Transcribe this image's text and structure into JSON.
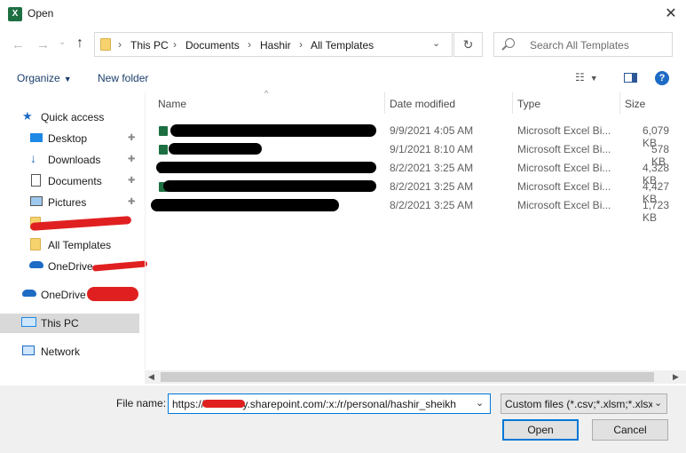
{
  "window": {
    "title": "Open",
    "app_icon_letter": "X"
  },
  "address": {
    "segments": [
      "This PC",
      "Documents",
      "Hashir",
      "All Templates"
    ]
  },
  "search": {
    "placeholder": "Search All Templates"
  },
  "toolbar": {
    "organize": "Organize",
    "new_folder": "New folder",
    "help": "?"
  },
  "columns": {
    "name": "Name",
    "date": "Date modified",
    "type": "Type",
    "size": "Size"
  },
  "files": [
    {
      "date": "9/9/2021 4:05 AM",
      "type": "Microsoft Excel Bi...",
      "size": "6,079 KB"
    },
    {
      "date": "9/1/2021 8:10 AM",
      "type": "Microsoft Excel Bi...",
      "size": "578 KB"
    },
    {
      "date": "8/2/2021 3:25 AM",
      "type": "Microsoft Excel Bi...",
      "size": "4,328 KB"
    },
    {
      "date": "8/2/2021 3:25 AM",
      "type": "Microsoft Excel Bi...",
      "size": "4,427 KB"
    },
    {
      "date": "8/2/2021 3:25 AM",
      "type": "Microsoft Excel Bi...",
      "size": "1,723 KB"
    }
  ],
  "sidebar": {
    "items": [
      {
        "label": "Quick access",
        "icon": "star-icon"
      },
      {
        "label": "Desktop",
        "icon": "desktop-icon"
      },
      {
        "label": "Downloads",
        "icon": "download-icon"
      },
      {
        "label": "Documents",
        "icon": "document-icon"
      },
      {
        "label": "Pictures",
        "icon": "picture-icon"
      },
      {
        "label": "",
        "icon": "folder-icon"
      },
      {
        "label": "All Templates",
        "icon": "folder-icon"
      },
      {
        "label": "OneDrive",
        "icon": "cloud-icon"
      },
      {
        "label": "OneDrive",
        "icon": "cloud-icon"
      },
      {
        "label": "This PC",
        "icon": "computer-icon"
      },
      {
        "label": "Network",
        "icon": "network-icon"
      }
    ]
  },
  "bottom": {
    "file_name_label": "File name:",
    "file_name_value": "https://          my.sharepoint.com/:x:/r/personal/hashir_sheikh",
    "filter": "Custom files (*.csv;*.xlsm;*.xlsx",
    "open": "Open",
    "cancel": "Cancel"
  },
  "colors": {
    "accent": "#0078d7",
    "selected_bg": "#cce8ff",
    "excel_green": "#1d6f42",
    "redaction_red": "#e02020"
  }
}
